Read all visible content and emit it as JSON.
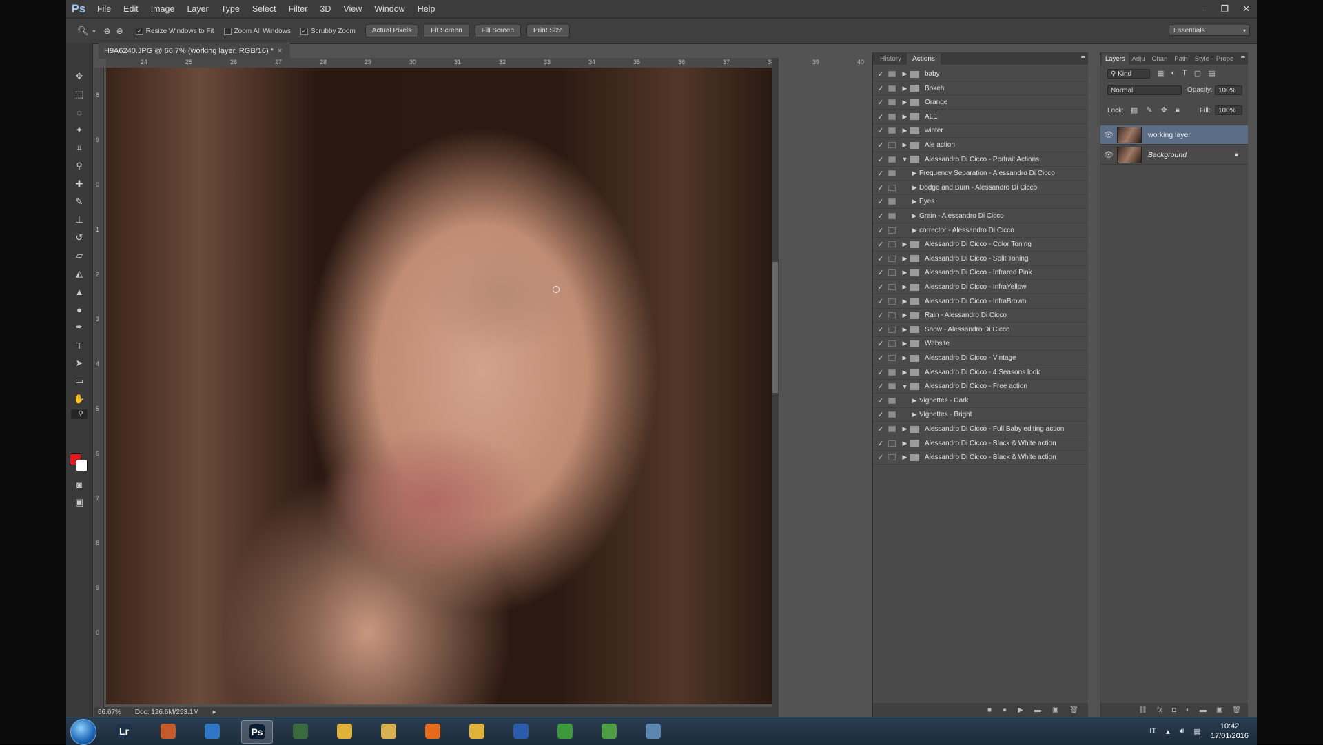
{
  "app": {
    "logo": "Ps",
    "menu": [
      "File",
      "Edit",
      "Image",
      "Layer",
      "Type",
      "Select",
      "Filter",
      "3D",
      "View",
      "Window",
      "Help"
    ],
    "window_controls": [
      "minimize-icon",
      "restore-icon",
      "close-icon"
    ]
  },
  "options_bar": {
    "checkboxes": [
      {
        "label": "Resize Windows to Fit",
        "checked": true
      },
      {
        "label": "Zoom All Windows",
        "checked": false
      },
      {
        "label": "Scrubby Zoom",
        "checked": true
      }
    ],
    "buttons": [
      "Actual Pixels",
      "Fit Screen",
      "Fill Screen",
      "Print Size"
    ],
    "workspace": "Essentials"
  },
  "document": {
    "tab_title": "H9A6240.JPG @ 66,7% (working layer, RGB/16) *",
    "ruler_h": [
      "24",
      "25",
      "26",
      "27",
      "28",
      "29",
      "30",
      "31",
      "32",
      "33",
      "34",
      "35",
      "36",
      "37",
      "38",
      "39",
      "40"
    ],
    "ruler_v": [
      "8",
      "9",
      "0",
      "1",
      "2",
      "3",
      "4",
      "5",
      "6",
      "7",
      "8",
      "9",
      "0"
    ],
    "zoom": "66.67%",
    "doc_size": "Doc: 126.6M/253.1M"
  },
  "actions_panel": {
    "tabs": [
      "History",
      "Actions"
    ],
    "active_tab": "Actions",
    "rows": [
      {
        "label": "baby",
        "level": 0,
        "expanded": false,
        "dialog": true
      },
      {
        "label": "Bokeh",
        "level": 0,
        "expanded": false,
        "dialog": true
      },
      {
        "label": "Orange",
        "level": 0,
        "expanded": false,
        "dialog": true
      },
      {
        "label": "ALE",
        "level": 0,
        "expanded": false,
        "dialog": true
      },
      {
        "label": "winter",
        "level": 0,
        "expanded": false,
        "dialog": true
      },
      {
        "label": "Ale action",
        "level": 0,
        "expanded": false,
        "dialog": false
      },
      {
        "label": "Alessandro Di Cicco - Portrait Actions",
        "level": 0,
        "expanded": true,
        "dialog": true
      },
      {
        "label": "Frequency Separation - Alessandro Di Cicco",
        "level": 1,
        "expanded": false,
        "dialog": true
      },
      {
        "label": "Dodge and Burn - Alessandro Di Cicco",
        "level": 1,
        "expanded": false,
        "dialog": false
      },
      {
        "label": "Eyes",
        "level": 1,
        "expanded": false,
        "dialog": true
      },
      {
        "label": "Grain - Alessandro Di Cicco",
        "level": 1,
        "expanded": false,
        "dialog": true
      },
      {
        "label": "corrector - Alessandro Di Cicco",
        "level": 1,
        "expanded": false,
        "dialog": false
      },
      {
        "label": "Alessandro Di Cicco - Color Toning",
        "level": 0,
        "expanded": false,
        "dialog": false
      },
      {
        "label": "Alessandro Di Cicco - Split Toning",
        "level": 0,
        "expanded": false,
        "dialog": false
      },
      {
        "label": "Alessandro Di Cicco - Infrared Pink",
        "level": 0,
        "expanded": false,
        "dialog": false
      },
      {
        "label": "Alessandro Di Cicco - InfraYellow",
        "level": 0,
        "expanded": false,
        "dialog": false
      },
      {
        "label": "Alessandro Di Cicco - InfraBrown",
        "level": 0,
        "expanded": false,
        "dialog": false
      },
      {
        "label": "Rain - Alessandro Di Cicco",
        "level": 0,
        "expanded": false,
        "dialog": false
      },
      {
        "label": "Snow - Alessandro Di Cicco",
        "level": 0,
        "expanded": false,
        "dialog": false
      },
      {
        "label": "Website",
        "level": 0,
        "expanded": false,
        "dialog": false
      },
      {
        "label": "Alessandro Di Cicco - Vintage",
        "level": 0,
        "expanded": false,
        "dialog": false
      },
      {
        "label": "Alessandro Di Cicco - 4 Seasons look",
        "level": 0,
        "expanded": false,
        "dialog": true
      },
      {
        "label": "Alessandro Di Cicco - Free action",
        "level": 0,
        "expanded": true,
        "dialog": true
      },
      {
        "label": "Vignettes - Dark",
        "level": 1,
        "expanded": false,
        "dialog": true
      },
      {
        "label": "Vignettes - Bright",
        "level": 1,
        "expanded": false,
        "dialog": true
      },
      {
        "label": "Alessandro Di Cicco - Full Baby editing action",
        "level": 0,
        "expanded": false,
        "dialog": true
      },
      {
        "label": "Alessandro Di Cicco - Black & White action",
        "level": 0,
        "expanded": false,
        "dialog": false
      },
      {
        "label": "Alessandro Di Cicco - Black & White action",
        "level": 0,
        "expanded": false,
        "dialog": false
      }
    ]
  },
  "layers_panel": {
    "tabs": [
      "Layers",
      "Adju",
      "Chan",
      "Path",
      "Style",
      "Prope"
    ],
    "kind_filter": "Kind",
    "blend_mode": "Normal",
    "opacity_label": "Opacity:",
    "opacity": "100%",
    "lock_label": "Lock:",
    "fill_label": "Fill:",
    "fill": "100%",
    "layers": [
      {
        "name": "working layer",
        "active": true,
        "italic": false,
        "locked": false
      },
      {
        "name": "Background",
        "active": false,
        "italic": true,
        "locked": true
      }
    ]
  },
  "taskbar": {
    "items": [
      "Lr",
      "",
      "",
      "Ps",
      "",
      "",
      "",
      "",
      "",
      "",
      "",
      "",
      ""
    ],
    "language": "IT",
    "time": "10:42",
    "date": "17/01/2016"
  },
  "colors": {
    "foreground": "#e4171c",
    "background": "#ffffff",
    "active_layer": "#5c6d88"
  }
}
